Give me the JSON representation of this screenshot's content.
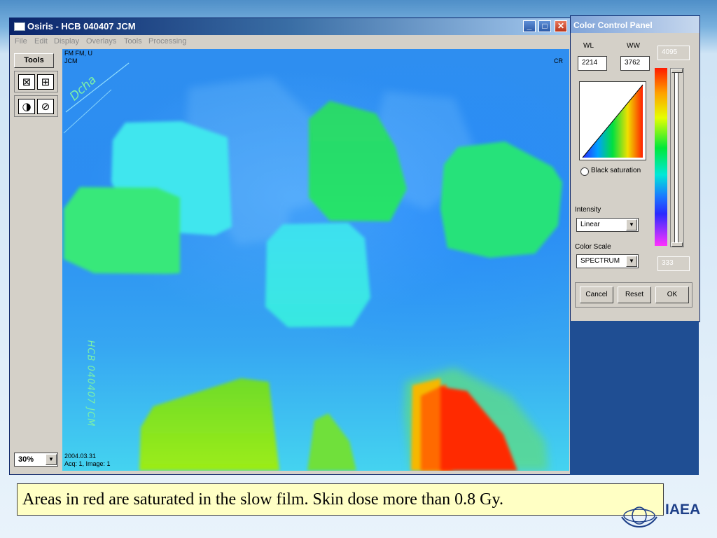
{
  "window": {
    "title": "Osiris - HCB 040407 JCM",
    "menus": [
      "File",
      "Edit",
      "Display",
      "Overlays",
      "Tools",
      "Processing"
    ],
    "controls": {
      "minimize": "_",
      "maximize": "□",
      "close": "✕"
    }
  },
  "toolbar": {
    "tools_label": "Tools",
    "icons": {
      "fit": "⊠",
      "shrink": "⊞",
      "contrast": "◑",
      "invert": "⊘"
    },
    "zoom": {
      "value": "30%",
      "arrow": "▼"
    }
  },
  "image": {
    "top_left": [
      "FM FM, U",
      "JCM"
    ],
    "top_right": "CR",
    "bottom_left": [
      "2004.03.31",
      "Acq: 1, Image: 1"
    ],
    "handwriting": {
      "signature": "Dcha",
      "side_note": "HCB 040407 JCM"
    }
  },
  "color_panel": {
    "title": "Color Control Panel",
    "wl_label": "WL",
    "ww_label": "WW",
    "wl_value": "2214",
    "ww_value": "3762",
    "scale_max": "4095",
    "scale_min": "333",
    "black_saturation_label": "Black saturation",
    "intensity_label": "Intensity",
    "intensity_value": "Linear",
    "color_scale_label": "Color Scale",
    "color_scale_value": "SPECTRUM",
    "cancel": "Cancel",
    "reset": "Reset",
    "ok": "OK",
    "arrow": "▼"
  },
  "caption": "Areas in red are saturated in the slow film. Skin dose more than 0.8 Gy.",
  "footer": {
    "logo_text": "IAEA"
  },
  "colors": {
    "title_bar": "#0a246a",
    "window_bg": "#d4d0c8",
    "caption_bg": "#ffffc4",
    "dose_low": "#2e8ef0",
    "dose_mid": "#33e85a",
    "dose_high": "#ff2200"
  }
}
